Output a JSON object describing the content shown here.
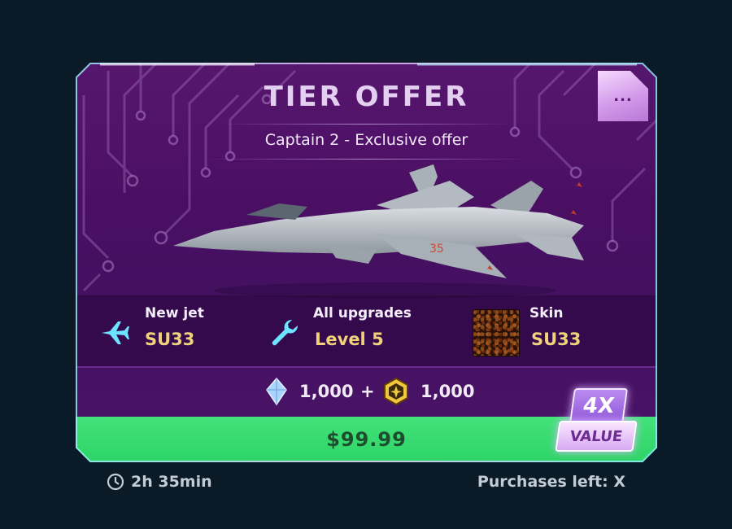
{
  "offer": {
    "title": "TIER OFFER",
    "subtitle": "Captain 2 - Exclusive offer",
    "more_label": "...",
    "jet_marking": "35"
  },
  "rewards": [
    {
      "title": "New jet",
      "value": "SU33",
      "icon": "jet-icon"
    },
    {
      "title": "All upgrades",
      "value": "Level 5",
      "icon": "wrench-icon"
    },
    {
      "title": "Skin",
      "value": "SU33",
      "icon": "skin-swatch"
    }
  ],
  "costs": {
    "crystal_amount": "1,000",
    "plus": "+",
    "coin_amount": "1,000",
    "crystal_icon": "crystal-icon",
    "coin_icon": "coin-icon"
  },
  "price": {
    "label": "$99.99"
  },
  "badge": {
    "multiplier": "4X",
    "label": "VALUE"
  },
  "footer": {
    "timer": "2h 35min",
    "purchases": "Purchases left: X"
  },
  "colors": {
    "card_bg": "#4a0f63",
    "price_bar": "#3ddc72",
    "reward_value": "#f0d27b",
    "accent_cyan": "#6de3ff"
  }
}
